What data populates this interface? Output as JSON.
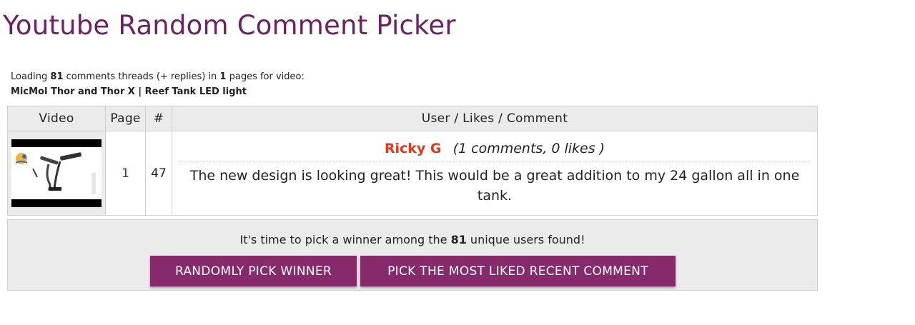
{
  "title": "Youtube Random Comment Picker",
  "loading": {
    "prefix": "Loading ",
    "threads": "81",
    "mid": " comments threads (+ replies) in ",
    "pages": "1",
    "suffix": " pages for video:",
    "video_title": "MicMol Thor and Thor X | Reef Tank LED light"
  },
  "table": {
    "headers": [
      "Video",
      "Page",
      "#",
      "User / Likes / Comment"
    ],
    "row": {
      "page": "1",
      "index": "47",
      "username": "Ricky G",
      "stats": "(1 comments, 0 likes )",
      "comment": "The new design is looking great! This would be a great addition to my 24 gallon all in one tank."
    }
  },
  "pick": {
    "prefix": "It's time to pick a winner among the ",
    "count": "81",
    "suffix": " unique users found!",
    "random_button": "RANDOMLY PICK WINNER",
    "liked_button": "PICK THE MOST LIKED RECENT COMMENT"
  },
  "colors": {
    "title": "#6e2160",
    "username": "#e8361c",
    "button": "#862a6b"
  }
}
